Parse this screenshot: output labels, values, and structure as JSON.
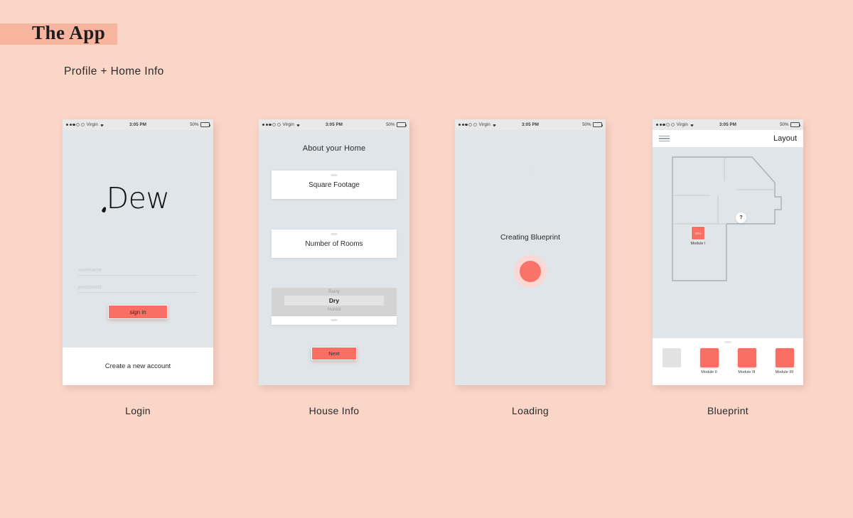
{
  "header": {
    "title": "The App",
    "subtitle": "Profile + Home Info",
    "band_color": "#f7b5a0",
    "background_color": "#fad6c8"
  },
  "theme": {
    "accent": "#fa6f63",
    "screen_bg": "#dfe5e8",
    "card_bg": "#ffffff",
    "statusbar_bg": "#e9e9e9"
  },
  "statusbar": {
    "carrier": "Virgin",
    "time": "3:05 PM",
    "battery_percent": "50%",
    "signal_dots_filled": 3,
    "signal_dots_hollow": 2,
    "wifi_icon": "wifi-icon"
  },
  "screens": [
    {
      "caption": "Login",
      "logo": "Dew",
      "username_placeholder": "username",
      "password_placeholder": "password",
      "signin_label": "sign in",
      "create_account_label": "Create a new account"
    },
    {
      "caption": "House Info",
      "title": "About your Home",
      "field_square_footage": "Square Footage",
      "field_number_of_rooms": "Number of Rooms",
      "picker_options": [
        "Rainy",
        "Dry",
        "Humid"
      ],
      "picker_selected": "Dry",
      "next_label": "Next"
    },
    {
      "caption": "Loading",
      "status_label": "Creating Blueprint"
    },
    {
      "caption": "Blueprint",
      "nav_title": "Layout",
      "menu_icon": "hamburger-icon",
      "help_badge": "?",
      "placed_module": {
        "label": "Module I",
        "value": "30%"
      },
      "tray_items": [
        {
          "label": "",
          "filled": false
        },
        {
          "label": "Module II",
          "filled": true
        },
        {
          "label": "Module III",
          "filled": true
        },
        {
          "label": "Module IIII",
          "filled": true
        }
      ]
    }
  ]
}
